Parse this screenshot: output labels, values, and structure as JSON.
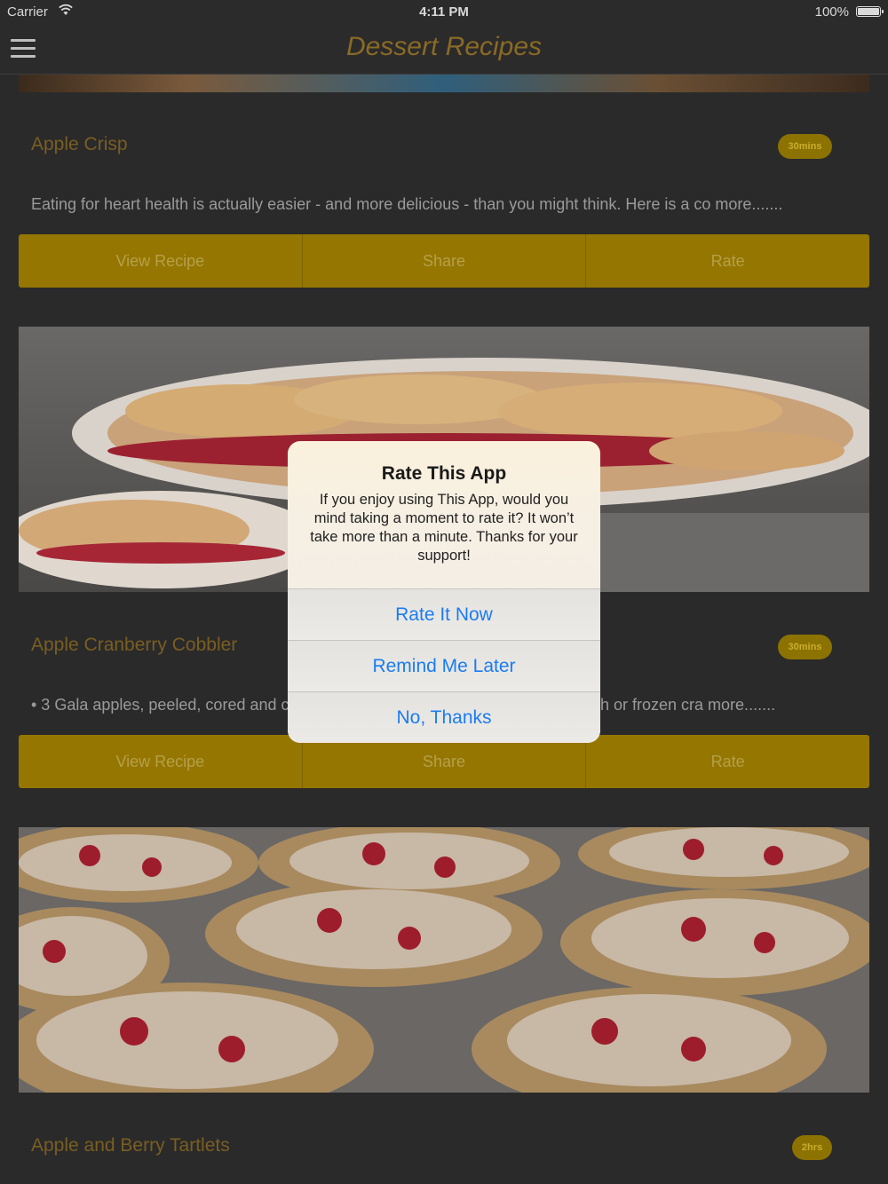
{
  "status_bar": {
    "carrier": "Carrier",
    "time": "4:11 PM",
    "battery": "100%"
  },
  "nav": {
    "title": "Dessert Recipes"
  },
  "recipes": [
    {
      "title": "Apple Crisp",
      "time": "30mins",
      "description": "Eating for heart health is actually easier - and more delicious - than you might think. Here is a co more.......",
      "buttons": {
        "view": "View Recipe",
        "share": "Share",
        "rate": "Rate"
      }
    },
    {
      "title": "Apple Cranberry Cobbler",
      "time": "30mins",
      "description_left": "• 3 Gala apples, peeled, cored and c",
      "description_right": "h or frozen cra more.......",
      "buttons": {
        "view": "View Recipe",
        "share": "Share",
        "rate": "Rate"
      }
    },
    {
      "title": "Apple and Berry Tartlets",
      "time": "2hrs"
    }
  ],
  "alert": {
    "title": "Rate This App",
    "message": "If you enjoy using This App, would you mind taking a moment to rate it? It won’t take more than a minute. Thanks for your support!",
    "actions": [
      "Rate It Now",
      "Remind Me Later",
      "No, Thanks"
    ]
  }
}
